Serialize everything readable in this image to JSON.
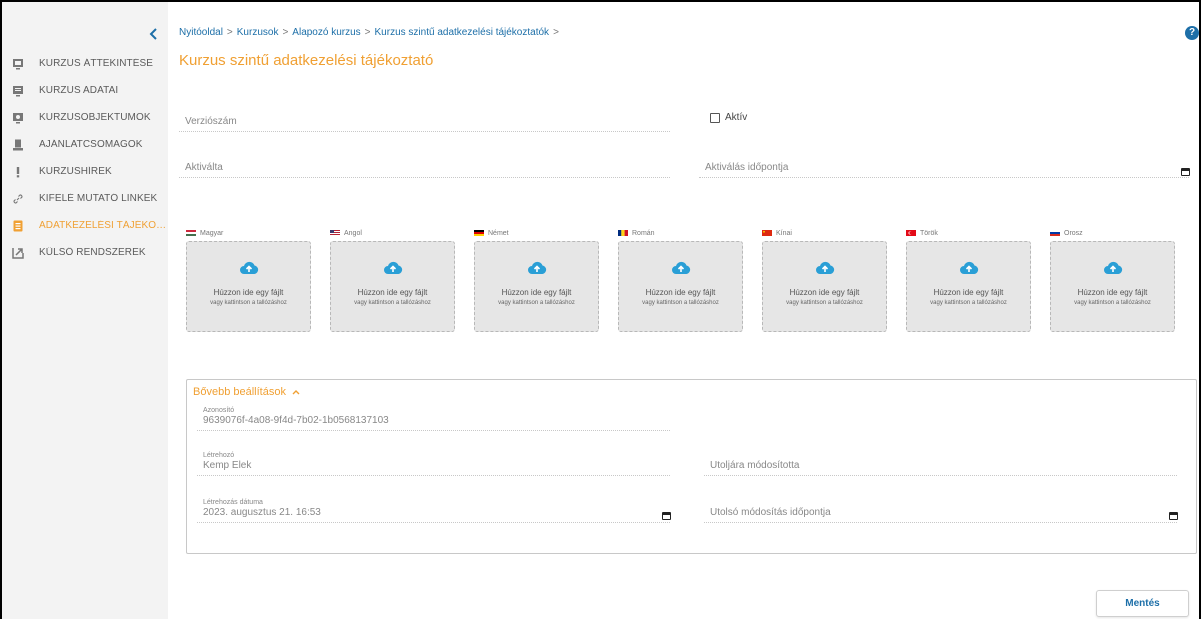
{
  "colors": {
    "accent": "#f0a033",
    "link": "#1d6fa8",
    "sidebar_bg": "#f3f3f3"
  },
  "sidebar": {
    "collapse_icon": "chevron-left-icon",
    "items": [
      {
        "label": "KURZUS ÁTTEKINTÉSE",
        "icon": "overview-icon"
      },
      {
        "label": "KURZUS ADATAI",
        "icon": "monitor-icon"
      },
      {
        "label": "KURZUSOBJEKTUMOK",
        "icon": "objects-icon"
      },
      {
        "label": "AJÁNLATCSOMAGOK",
        "icon": "package-icon"
      },
      {
        "label": "KURZUSHÍREK",
        "icon": "exclamation-icon"
      },
      {
        "label": "KIFELÉ MUTATÓ LINKEK",
        "icon": "link-icon"
      },
      {
        "label": "ADATKEZELÉSI TÁJÉKOZTATÓ",
        "icon": "document-icon",
        "active": true
      },
      {
        "label": "KÜLSŐ RENDSZEREK",
        "icon": "external-icon"
      }
    ]
  },
  "breadcrumb": [
    "Nyitóoldal",
    "Kurzusok",
    "Alapozó kurzus",
    "Kurzus szintű adatkezelési tájékoztatók"
  ],
  "breadcrumb_sep": ">",
  "help_label": "?",
  "page_title": "Kurzus szintű adatkezelési tájékoztató",
  "form": {
    "version_placeholder": "Verziószám",
    "active_label": "Aktív",
    "activated_by_placeholder": "Aktiválta",
    "activation_time_placeholder": "Aktiválás időpontja"
  },
  "languages": [
    {
      "name": "Magyar",
      "flag": "hu"
    },
    {
      "name": "Angol",
      "flag": "us"
    },
    {
      "name": "Német",
      "flag": "de"
    },
    {
      "name": "Román",
      "flag": "ro"
    },
    {
      "name": "Kínai",
      "flag": "cn"
    },
    {
      "name": "Török",
      "flag": "tr"
    },
    {
      "name": "Orosz",
      "flag": "ru"
    }
  ],
  "dropzone": {
    "title": "Húzzon ide egy fájlt",
    "subtitle": "vagy kattintson a tallózáshoz",
    "icon": "cloud-upload-icon"
  },
  "advanced": {
    "title": "Bővebb beállítások",
    "id_label": "Azonosító",
    "id_value": "9639076f-4a08-9f4d-7b02-1b0568137103",
    "creator_label": "Létrehozó",
    "creator_value": "Kemp Elek",
    "last_modified_by_placeholder": "Utoljára módosította",
    "created_at_label": "Létrehozás dátuma",
    "created_at_value": "2023. augusztus 21. 16:53",
    "last_modified_at_placeholder": "Utolsó módosítás időpontja"
  },
  "save_label": "Mentés"
}
